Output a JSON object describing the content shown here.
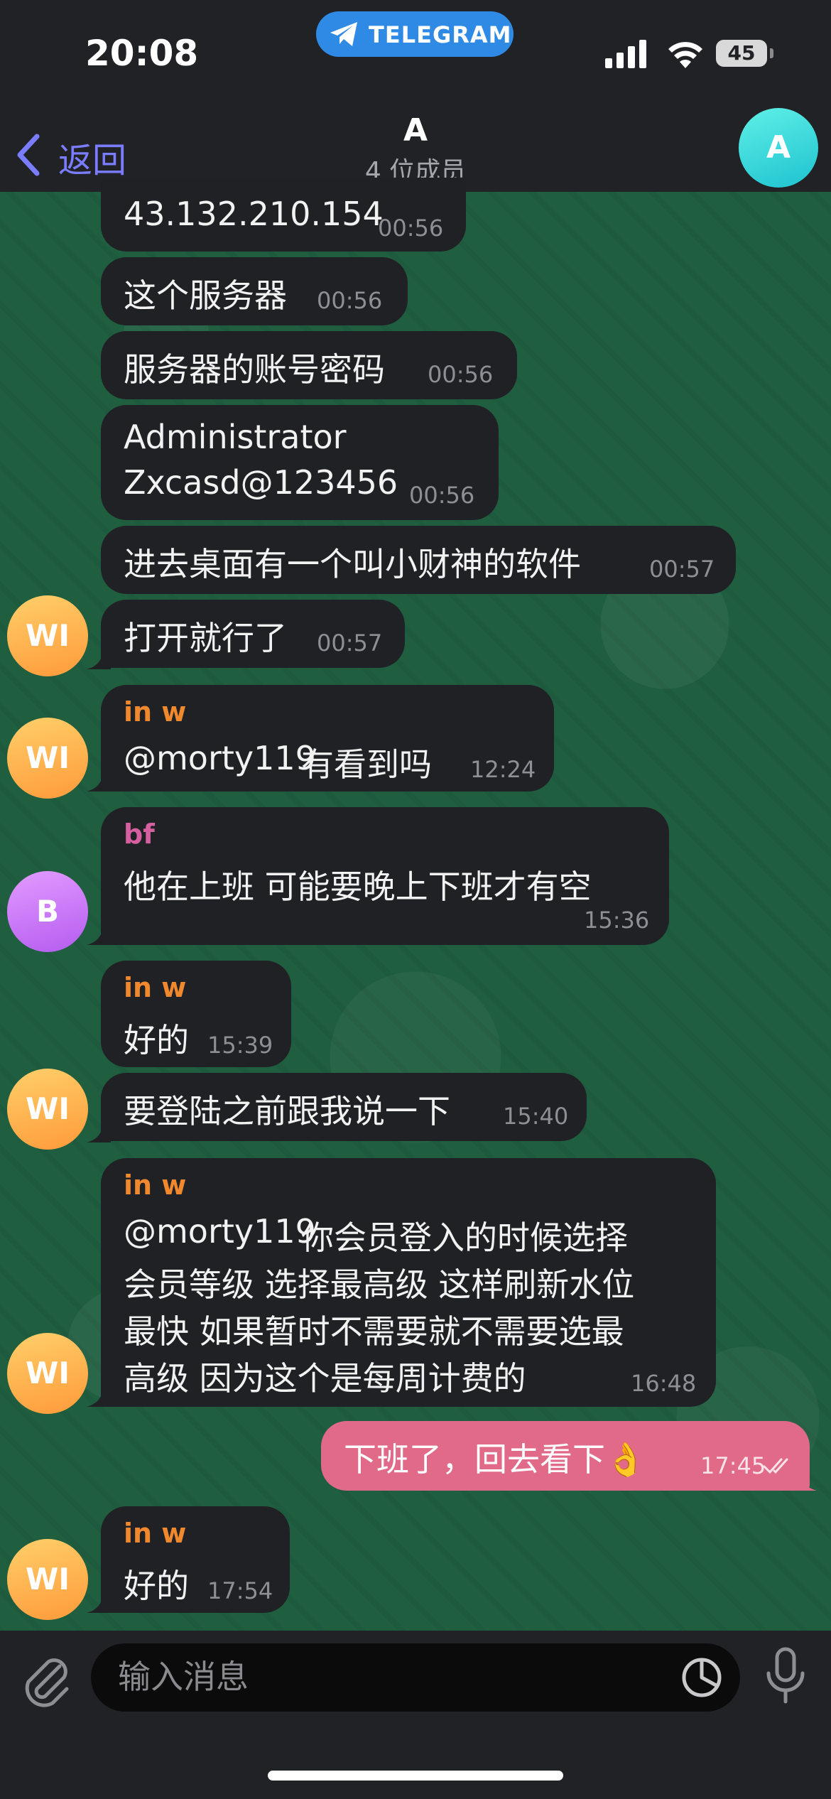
{
  "status_bar": {
    "time": "20:08",
    "app_pill": "TELEGRAM",
    "battery": "45"
  },
  "header": {
    "back_label": "返回",
    "title": "A",
    "subtitle": "4 位成员",
    "avatar_letter": "A"
  },
  "messages": [
    {
      "text": "43.132.210.154",
      "time": "00:56"
    },
    {
      "text": "这个服务器",
      "time": "00:56"
    },
    {
      "text": "服务器的账号密码",
      "time": "00:56"
    },
    {
      "lines": [
        "Administrator",
        "Zxcasd@123456"
      ],
      "time": "00:56"
    },
    {
      "text": "进去桌面有一个叫小财神的软件",
      "time": "00:57"
    },
    {
      "text": "打开就行了",
      "time": "00:57",
      "avatar": "WI"
    },
    {
      "sender": "in w",
      "mention": "@morty119",
      "text": " 有看到吗",
      "time": "12:24",
      "avatar": "WI"
    },
    {
      "sender": "bf",
      "text": "他在上班 可能要晚上下班才有空",
      "time": "15:36",
      "avatar": "B"
    },
    {
      "sender": "in w",
      "text": "好的",
      "time": "15:39"
    },
    {
      "text": "要登陆之前跟我说一下",
      "time": "15:40",
      "avatar": "WI"
    },
    {
      "sender": "in w",
      "mention": "@morty119",
      "lines": [
        " 你会员登入的时候选择",
        "会员等级 选择最高级 这样刷新水位",
        "最快 如果暂时不需要就不需要选最",
        "高级 因为这个是每周计费的"
      ],
      "time": "16:48",
      "avatar": "WI"
    },
    {
      "outgoing": true,
      "text": "下班了，回去看下👌",
      "time": "17:45"
    },
    {
      "sender": "in w",
      "text": "好的",
      "time": "17:54",
      "avatar": "WI"
    }
  ],
  "composer": {
    "placeholder": "输入消息"
  },
  "colors": {
    "accent": "#6f78ff",
    "outgoing_bubble": "#e06a88",
    "sender_inw": "#f0882e",
    "sender_bf": "#d65fa0"
  }
}
